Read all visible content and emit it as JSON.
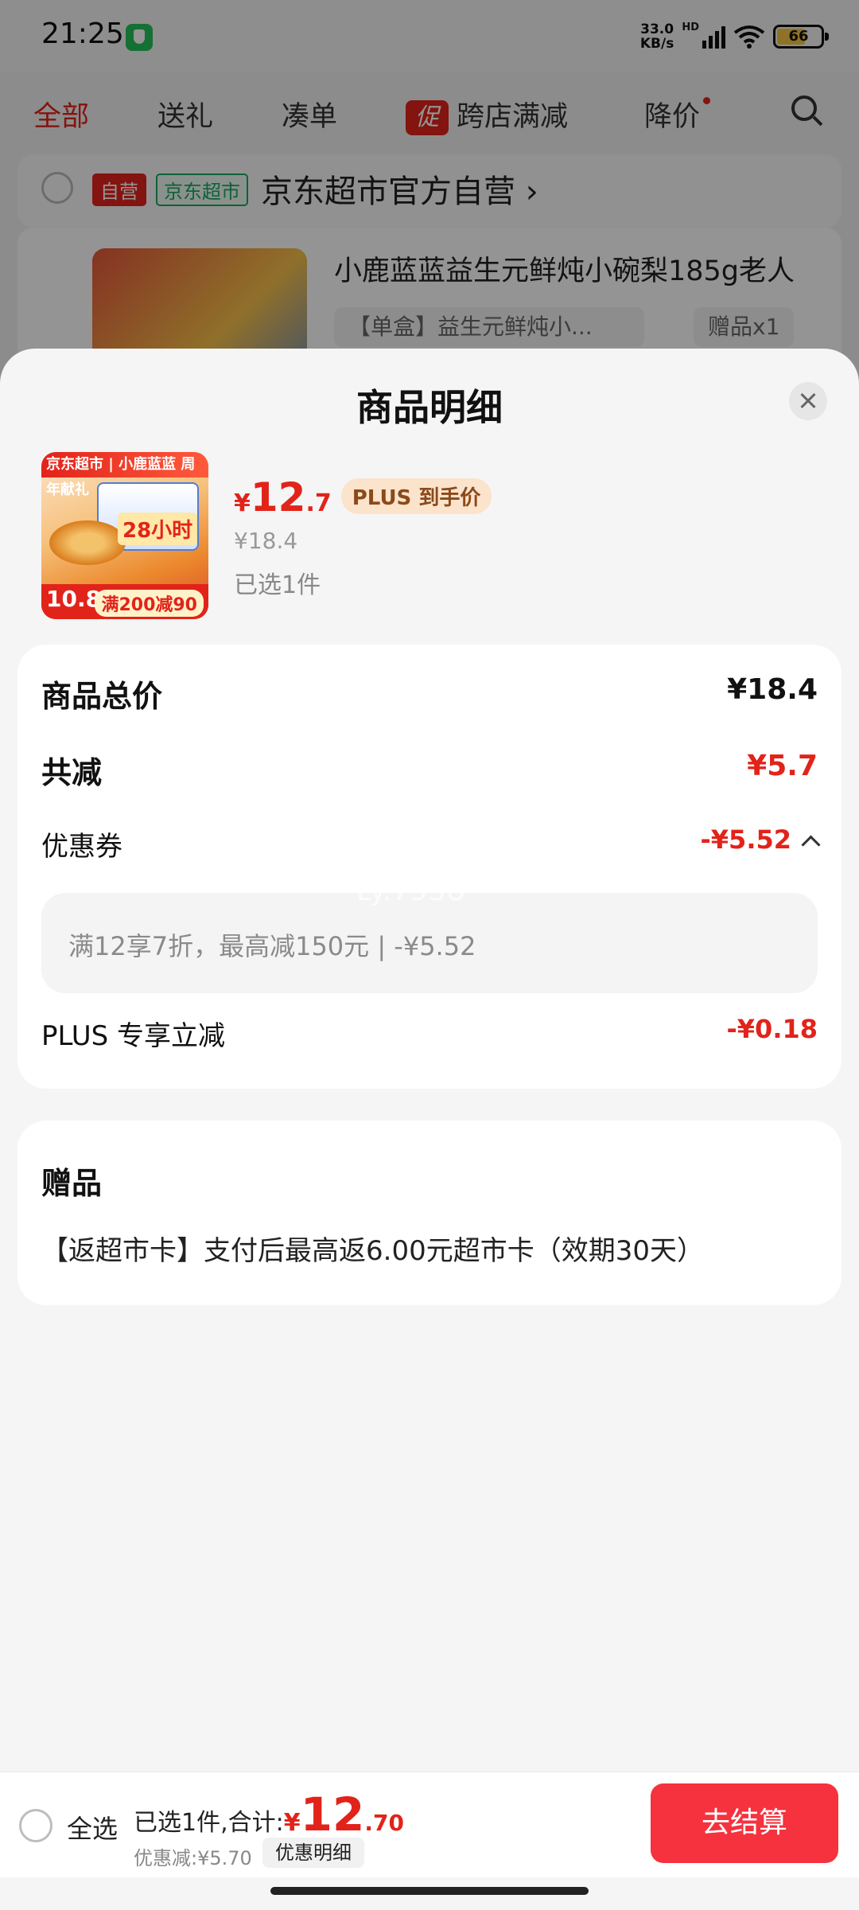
{
  "status_bar": {
    "time": "21:25",
    "net_speed_value": "33.0",
    "net_speed_unit": "KB/s",
    "network_badge": "HD",
    "wifi_badge": "6",
    "battery": "66",
    "icons": [
      "shield-icon",
      "signal-icon",
      "wifi-icon",
      "battery-icon"
    ]
  },
  "background_page": {
    "tabs": [
      {
        "label": "全部",
        "active": true
      },
      {
        "label": "送礼"
      },
      {
        "label": "凑单"
      },
      {
        "label": "跨店满减",
        "badge": "促"
      },
      {
        "label": "降价",
        "dot": true
      }
    ],
    "store": {
      "tag_self": "自营",
      "tag_market": "京东超市",
      "name": "京东超市官方自营",
      "chevron": "›"
    },
    "item": {
      "title": "小鹿蓝蓝益生元鲜炖小碗梨185g老人",
      "spec": "【单盒】益生元鲜炖小...",
      "gift": "赠品x1"
    }
  },
  "sheet": {
    "title": "商品明细",
    "product": {
      "image_texts": {
        "brand": "京东超市 | 小鹿蓝蓝 周年献礼",
        "hours": "28小时",
        "price_tag": "10.8",
        "promo": "满200减90"
      },
      "price_symbol": "¥",
      "price_int": "12",
      "price_dec": ".7",
      "plus_label": "PLUS 到手价",
      "original_price": "¥18.4",
      "selected": "已选1件"
    },
    "summary": {
      "total_label": "商品总价",
      "total_value": "¥18.4",
      "reduce_label": "共减",
      "reduce_value": "¥5.7",
      "coupon_label": "优惠券",
      "coupon_value": "-¥5.52",
      "coupon_detail": "满12享7折，最高减150元 | -¥5.52",
      "plus_label": "PLUS 专享立减",
      "plus_value": "-¥0.18"
    },
    "watermark": "Ly.75SU",
    "gift": {
      "title": "赠品",
      "desc": "【返超市卡】支付后最高返6.00元超市卡（效期30天）"
    }
  },
  "bottom_bar": {
    "select_all": "全选",
    "total_prefix": "已选1件,合计:",
    "total_symbol": "¥",
    "total_int": "12",
    "total_dec": ".70",
    "discount": "优惠减:¥5.70",
    "detail_button": "优惠明细",
    "checkout_button": "去结算"
  },
  "colors": {
    "accent_red": "#e2231a",
    "checkout_red": "#f5323e",
    "plus_badge_bg": "#fbe3cc",
    "store_green": "#1aa760"
  }
}
